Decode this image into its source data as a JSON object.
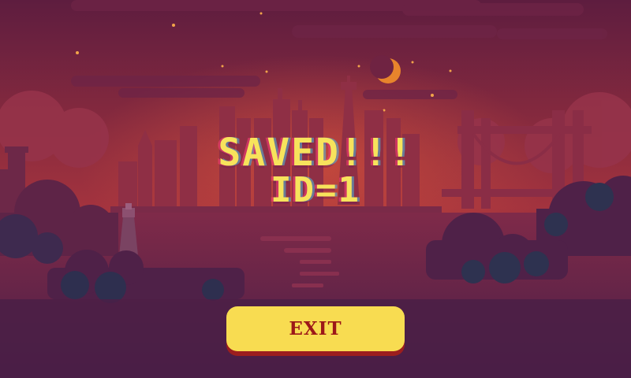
{
  "screen": {
    "message_line1": "SAVED!!!",
    "message_line2": "ID=1"
  },
  "exit_button": {
    "label": "EXIT"
  },
  "colors": {
    "sky_top": "#5e1d3f",
    "sky_bottom": "#a8363f",
    "text": "#f7e35c",
    "button": "#f8dc51",
    "button_text": "#9c1818",
    "moon": "#e8842c"
  },
  "icons": {
    "moon": "crescent-moon-icon"
  }
}
